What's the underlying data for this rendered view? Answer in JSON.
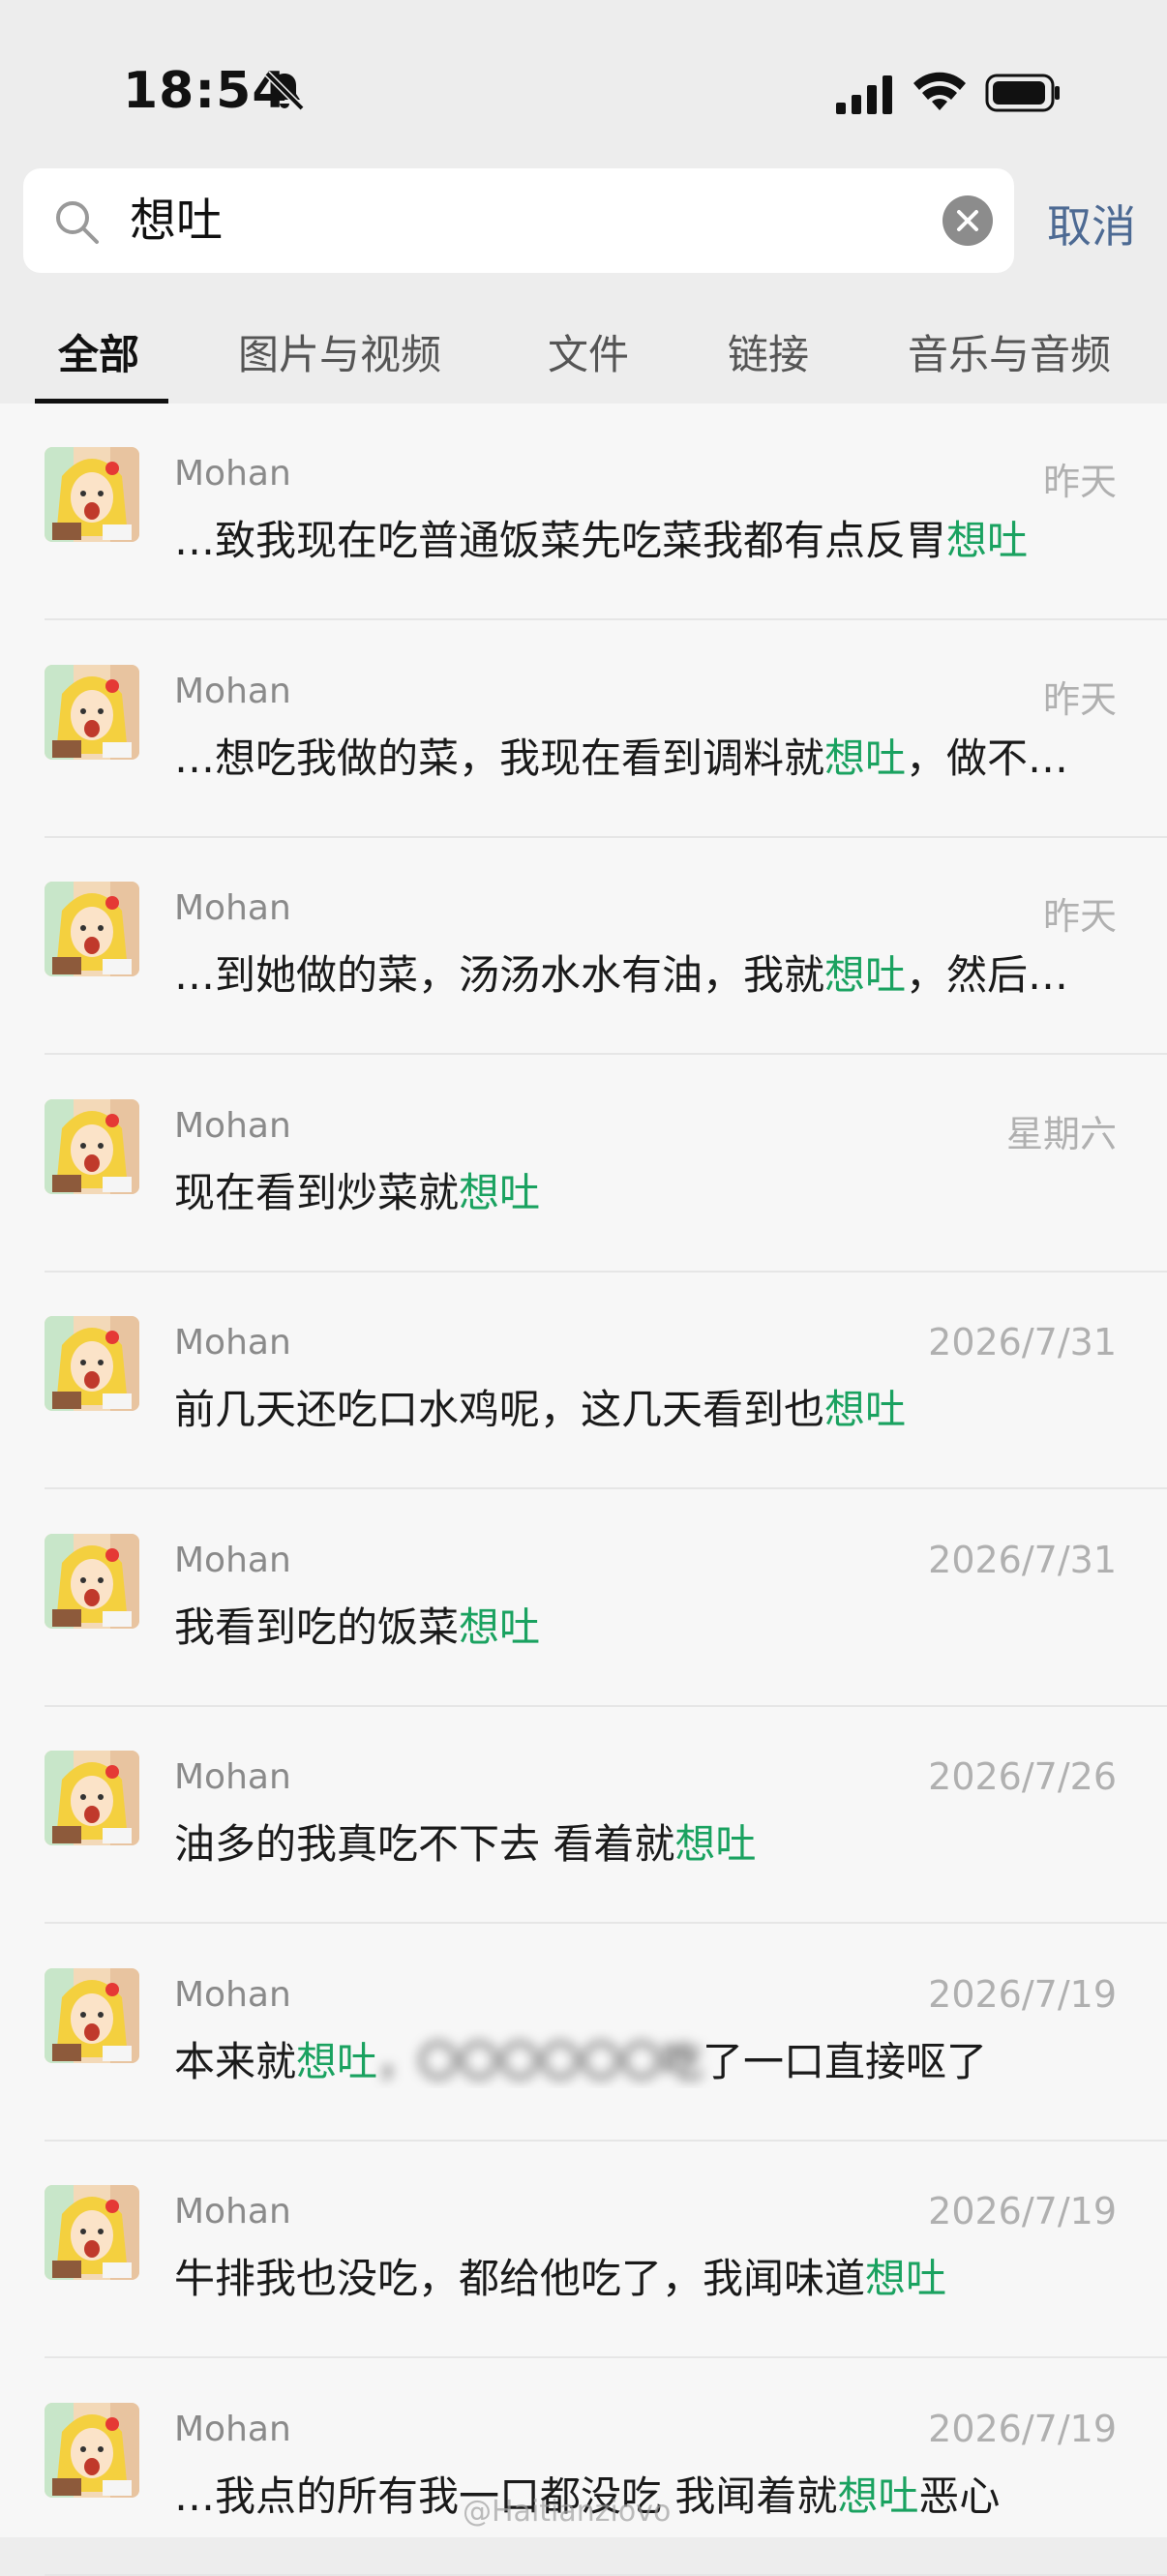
{
  "status_bar": {
    "time": "18:54"
  },
  "search": {
    "query": "想吐",
    "cancel_label": "取消"
  },
  "tabs": [
    {
      "label": "全部"
    },
    {
      "label": "图片与视频"
    },
    {
      "label": "文件"
    },
    {
      "label": "链接"
    },
    {
      "label": "音乐与音频"
    }
  ],
  "results": [
    {
      "sender": "Mohan",
      "date": "昨天",
      "pre": "…致我现在吃普通饭菜先吃菜我都有点反胃",
      "kw": "想吐",
      "post": ""
    },
    {
      "sender": "Mohan",
      "date": "昨天",
      "pre": "…想吃我做的菜，我现在看到调料就",
      "kw": "想吐",
      "post": "，做不…"
    },
    {
      "sender": "Mohan",
      "date": "昨天",
      "pre": "…到她做的菜，汤汤水水有油，我就",
      "kw": "想吐",
      "post": "，然后…"
    },
    {
      "sender": "Mohan",
      "date": "星期六",
      "pre": "现在看到炒菜就",
      "kw": "想吐",
      "post": ""
    },
    {
      "sender": "Mohan",
      "date": "2026/7/31",
      "pre": "前几天还吃口水鸡呢，这几天看到也",
      "kw": "想吐",
      "post": ""
    },
    {
      "sender": "Mohan",
      "date": "2026/7/31",
      "pre": "我看到吃的饭菜",
      "kw": "想吐",
      "post": ""
    },
    {
      "sender": "Mohan",
      "date": "2026/7/26",
      "pre": "油多的我真吃不下去 看着就",
      "kw": "想吐",
      "post": ""
    },
    {
      "sender": "Mohan",
      "date": "2026/7/19",
      "pre": "本来就",
      "kw": "想吐",
      "post": "了一口直接呕了",
      "blurred": "，〇〇〇〇〇〇吃"
    },
    {
      "sender": "Mohan",
      "date": "2026/7/19",
      "pre": "牛排我也没吃，都给他吃了，我闻味道",
      "kw": "想吐",
      "post": ""
    },
    {
      "sender": "Mohan",
      "date": "2026/7/19",
      "pre": "…我点的所有我一口都没吃 我闻着就",
      "kw": "想吐",
      "post": "恶心"
    }
  ],
  "watermark": "@Haitianziovo"
}
